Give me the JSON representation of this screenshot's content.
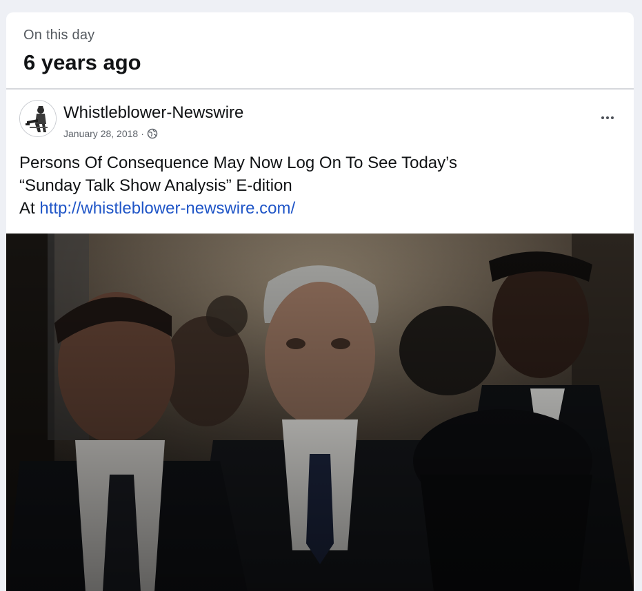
{
  "memory": {
    "kicker": "On this day",
    "title": "6 years ago"
  },
  "post": {
    "author": "Whistleblower-Newswire",
    "date": "January 28, 2018",
    "separator": "·",
    "privacy_icon": "globe-icon",
    "more_icon": "more-options-icon",
    "text_line1": "Persons Of Consequence May Now Log On To See Today’s",
    "text_line2": "“Sunday Talk Show Analysis” E-dition",
    "text_line3_prefix": "At ",
    "link": "http://whistleblower-newswire.com/",
    "image": "photo-men-in-suits-walking-hallway"
  },
  "colors": {
    "page_bg": "#eef0f5",
    "link": "#1f55c7",
    "meta_text": "#5f646b"
  }
}
